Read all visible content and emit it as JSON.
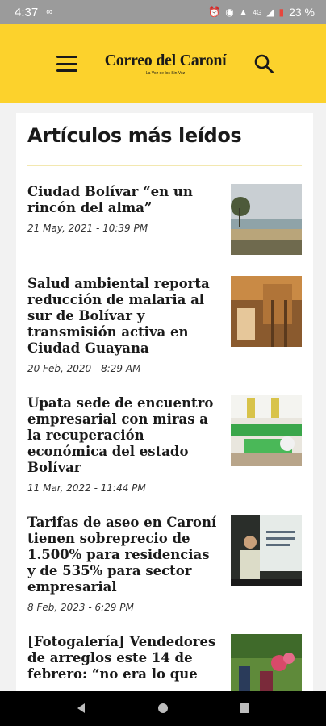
{
  "status_bar": {
    "time": "4:37",
    "battery_percent": "23 %",
    "network": "4G"
  },
  "header": {
    "logo_title": "Correo del Caroní",
    "logo_subtitle": "La Voz de los Sin Voz"
  },
  "section": {
    "title": "Artículos más leídos"
  },
  "articles": [
    {
      "title": "Ciudad Bolívar “en un rincón del alma”",
      "date": "21 May, 2021 - 10:39 PM"
    },
    {
      "title": "Salud ambiental reporta reducción de malaria al sur de Bolívar y transmisión activa en Ciudad Guayana",
      "date": "20 Feb, 2020 - 8:29 AM"
    },
    {
      "title": "Upata sede de encuentro empresarial con miras a la recuperación económica del estado Bolívar",
      "date": "11 Mar, 2022 - 11:44 PM"
    },
    {
      "title": "Tarifas de aseo en Caroní tienen sobreprecio de 1.500% para residencias y de 535% para sector empresarial",
      "date": "8 Feb, 2023 - 6:29 PM"
    },
    {
      "title": "[Fotogalería] Vendedores de arreglos este 14 de febrero: “no era lo que",
      "date": ""
    }
  ]
}
